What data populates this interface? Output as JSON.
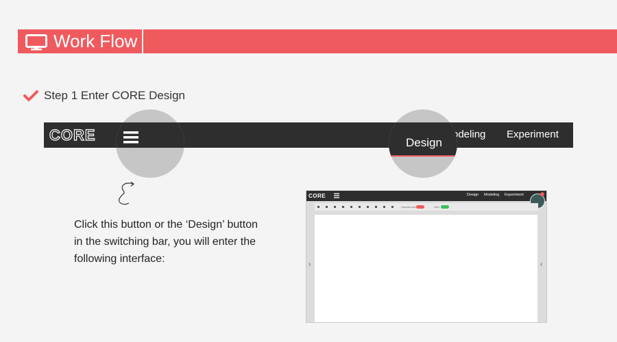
{
  "header": {
    "title": "Work Flow",
    "icon": "monitor-icon",
    "accent": "#ef5a5e"
  },
  "step": {
    "text": "Step 1 Enter CORE Design",
    "icon": "check-icon"
  },
  "core_bar": {
    "logo": "CORE",
    "nav": {
      "design": "Design",
      "modeling": "odeling",
      "experiment": "Experiment"
    }
  },
  "description": {
    "lines": [
      "Click this button or the ‘Design’ button",
      "in the switching bar, you will enter the",
      "following interface:"
    ]
  },
  "screenshot": {
    "logo": "CORE",
    "nav": [
      "Design",
      "Modeling",
      "Experiment"
    ],
    "toolbar": {
      "canvas_size_label": "Canvas size",
      "grid_label": "Grid"
    },
    "left_arrow": "›",
    "right_arrow": "‹"
  }
}
